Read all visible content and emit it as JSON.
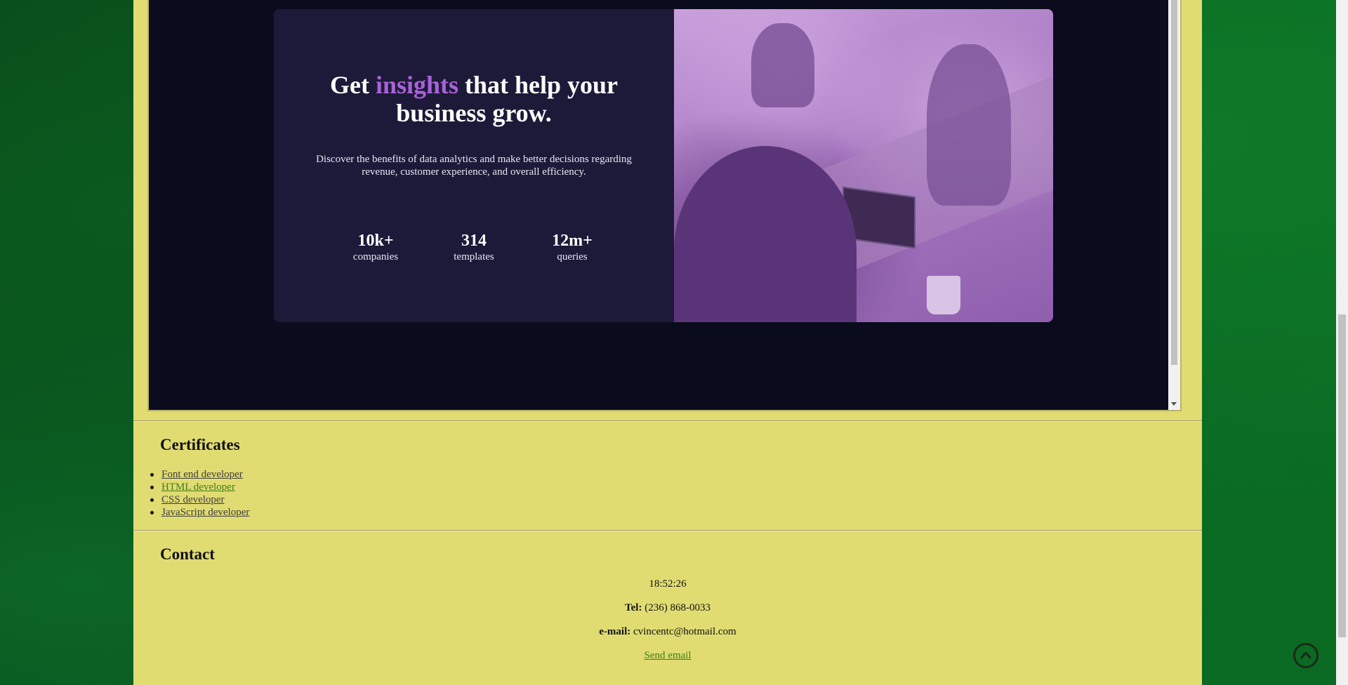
{
  "card": {
    "title_prefix": "Get ",
    "title_accent": "insights",
    "title_suffix": " that help your business grow.",
    "description": "Discover the benefits of data analytics and make better decisions regarding revenue, customer experience, and overall efficiency.",
    "stats": [
      {
        "value": "10k+",
        "label": "companies"
      },
      {
        "value": "314",
        "label": "templates"
      },
      {
        "value": "12m+",
        "label": "queries"
      }
    ]
  },
  "certificates": {
    "title": "Certificates",
    "items": [
      "Font end developer",
      "HTML developer",
      "CSS developer",
      "JavaScript developer"
    ]
  },
  "contact": {
    "title": "Contact",
    "time": "18:52:26",
    "tel_label": "Tel:",
    "tel_value": " (236) 868-0033",
    "email_label": "e-mail:",
    "email_value": " cvincentc@hotmail.com",
    "send_link": "Send email"
  },
  "icons": {
    "scroll_top": "chevron-up-circle-icon"
  },
  "colors": {
    "page_bg": "#e0dc72",
    "card_bg": "#1c1a38",
    "accent": "#a962d8",
    "visited_link": "#3e7d1a"
  }
}
